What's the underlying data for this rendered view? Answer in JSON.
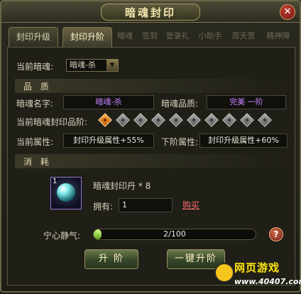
{
  "window": {
    "title": "暗魂封印",
    "close_glyph": "✕"
  },
  "tabs": [
    {
      "label": "封印升级",
      "active": false
    },
    {
      "label": "封印升阶",
      "active": true
    }
  ],
  "ghost_tabs": [
    "暗魂",
    "签到",
    "登录礼",
    "小助手",
    "周天营",
    "精神障"
  ],
  "current": {
    "label": "当前暗魂:",
    "value": "暗魂-杀"
  },
  "quality": {
    "section_title": "品 质",
    "name_label": "暗魂名字:",
    "name_value": "暗魂-杀",
    "grade_label": "暗魂品质:",
    "grade_value": "完美 一阶",
    "stage_label": "当前暗魂封印品阶:",
    "stage_total": 10,
    "stage_current": 1,
    "cur_attr_label": "当前属性:",
    "cur_attr_value": "封印升级属性+55%",
    "next_attr_label": "下阶属性:",
    "next_attr_value": "封印升级属性+60%"
  },
  "consume": {
    "section_title": "消 耗",
    "item_name": "暗魂封印丹 * 8",
    "item_count": "1",
    "own_label": "拥有:",
    "own_value": "1",
    "buy_label": "购买"
  },
  "calm": {
    "label": "宁心静气:",
    "text": "2/100",
    "progress": 0.02,
    "help": "?"
  },
  "buttons": {
    "upgrade": "升 阶",
    "one_click": "一键升阶"
  },
  "watermark": {
    "text": "网页游戏",
    "url": "www.40407.com"
  },
  "colors": {
    "accent": "#f3e7b0",
    "purple": "#c984ff",
    "orange_diamond": "#e8891f",
    "bar": "#8ad23c"
  }
}
